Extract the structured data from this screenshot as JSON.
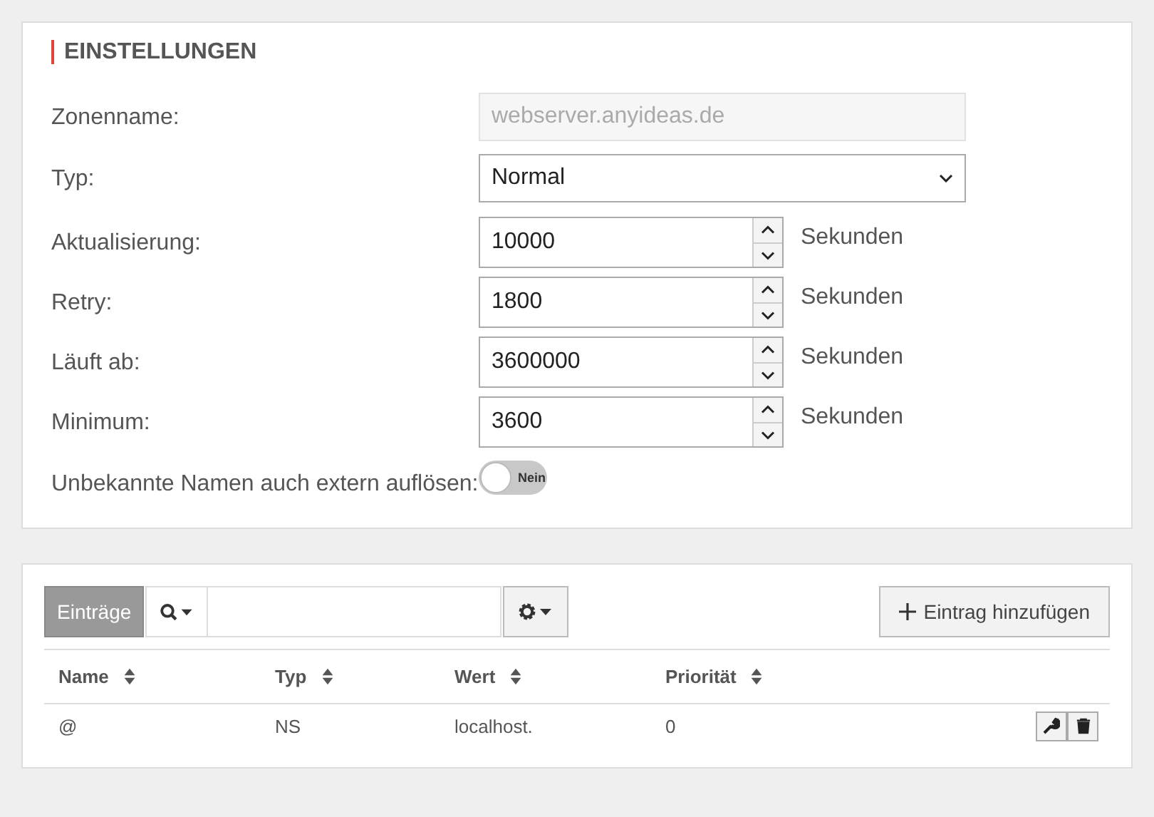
{
  "settings": {
    "title": "EINSTELLUNGEN",
    "fields": [
      {
        "kind": "text",
        "label": "Zonenname:",
        "value": "webserver.anyideas.de",
        "disabled": true
      },
      {
        "kind": "select",
        "label": "Typ:",
        "value": "Normal"
      },
      {
        "kind": "number",
        "label": "Aktualisierung:",
        "value": "10000",
        "unit": "Sekunden"
      },
      {
        "kind": "number",
        "label": "Retry:",
        "value": "1800",
        "unit": "Sekunden"
      },
      {
        "kind": "number",
        "label": "Läuft ab:",
        "value": "3600000",
        "unit": "Sekunden"
      },
      {
        "kind": "number",
        "label": "Minimum:",
        "value": "3600",
        "unit": "Sekunden"
      },
      {
        "kind": "toggle",
        "label": "Unbekannte Namen auch extern auflösen:",
        "on": false,
        "state_label": "Nein"
      }
    ]
  },
  "entries": {
    "tab": "Einträge",
    "add_button": "Eintrag hinzufügen",
    "columns": [
      "Name",
      "Typ",
      "Wert",
      "Priorität"
    ],
    "rows": [
      {
        "cells": [
          "@",
          "NS",
          "localhost.",
          "0"
        ]
      }
    ]
  }
}
